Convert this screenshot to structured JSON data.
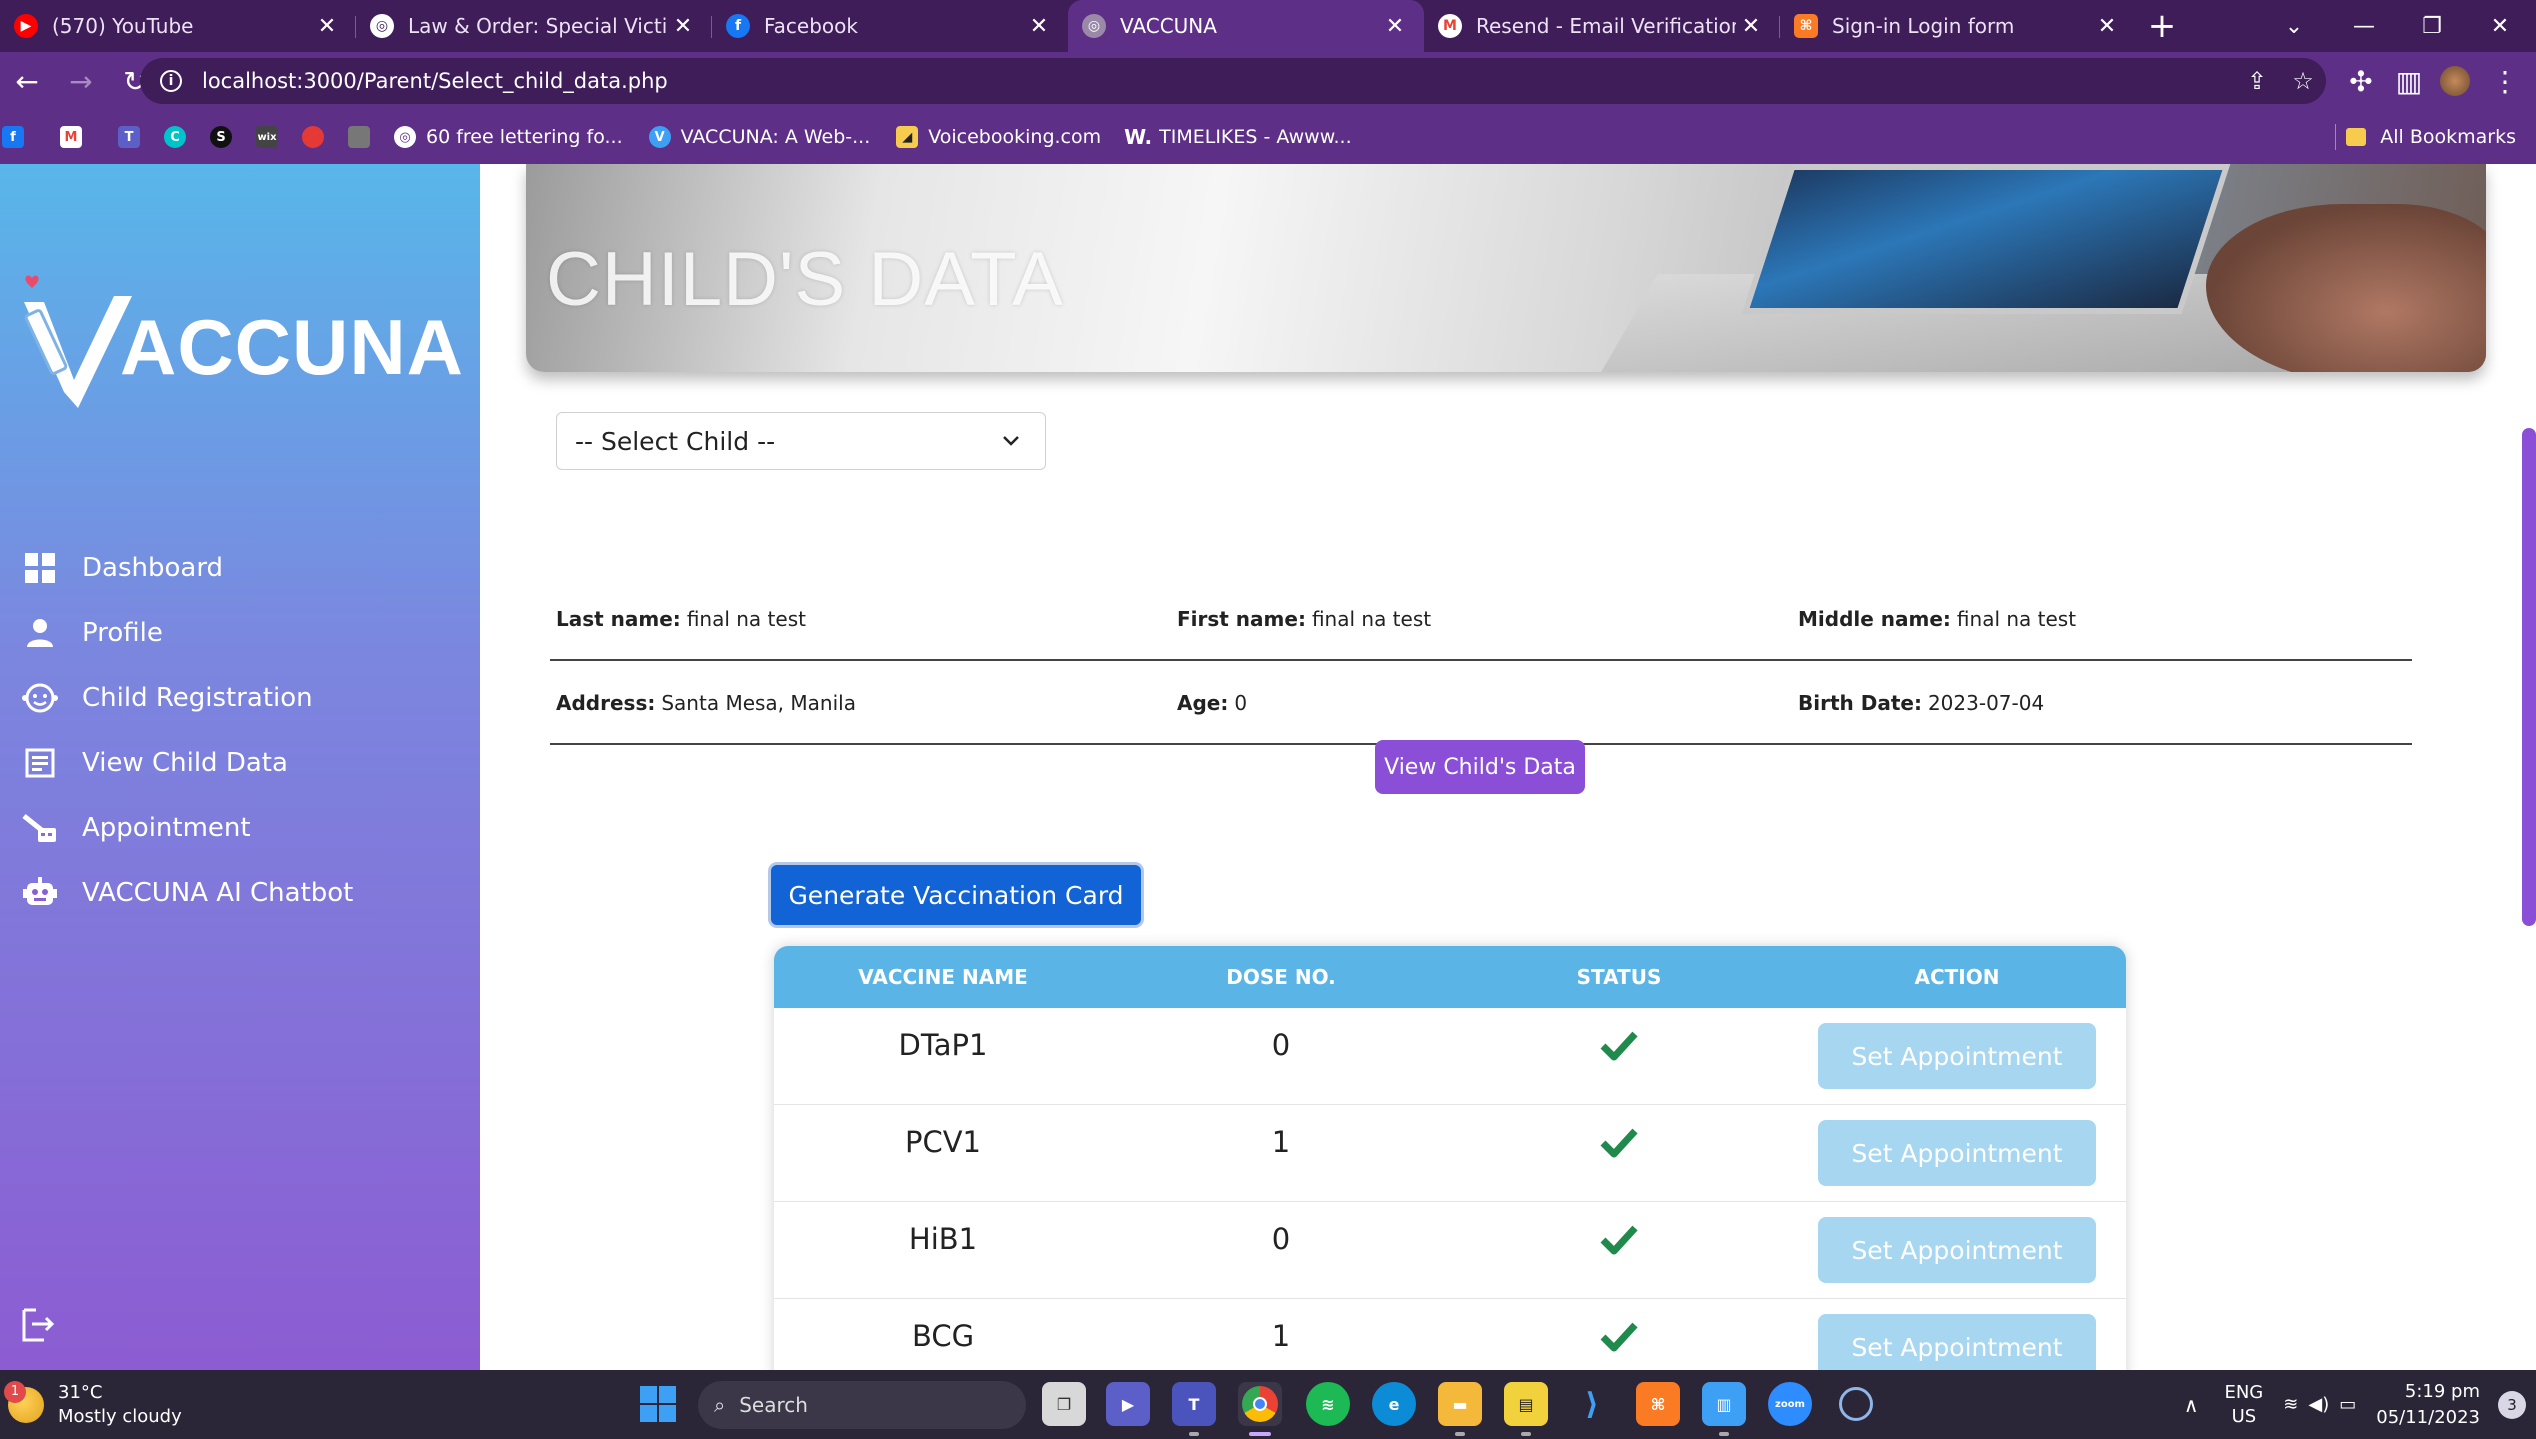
{
  "browser": {
    "tabs": [
      {
        "title": "(570) YouTube",
        "icon": "youtube-icon",
        "color": "#ff0000",
        "active": false
      },
      {
        "title": "Law & Order: Special Victims Un",
        "icon": "globe-icon",
        "color": "#ffffff",
        "active": false
      },
      {
        "title": "Facebook",
        "icon": "facebook-icon",
        "color": "#1877f2",
        "active": false
      },
      {
        "title": "VACCUNA",
        "icon": "globe-icon",
        "color": "#9a8aa8",
        "active": true
      },
      {
        "title": "Resend - Email Verification from",
        "icon": "gmail-icon",
        "color": "#ea4335",
        "active": false
      },
      {
        "title": "Sign-in Login form",
        "icon": "xampp-icon",
        "color": "#fb7a24",
        "active": false
      }
    ],
    "new_tab_label": "+",
    "url": "localhost:3000/Parent/Select_child_data.php",
    "bookmarks": [
      {
        "label": "60 free lettering fo...",
        "icon": "globe-icon",
        "color": "#ffffff"
      },
      {
        "label": "VACCUNA: A Web-...",
        "icon": "vaccuna-icon",
        "color": "#3ea0f5"
      },
      {
        "label": "Voicebooking.com",
        "icon": "voicebooking-icon",
        "color": "#f7cb4d"
      },
      {
        "label": "TIMELIKES - Awww...",
        "icon": "w-icon",
        "color": "#5e2f86"
      }
    ],
    "all_bookmarks_label": "All Bookmarks"
  },
  "sidebar": {
    "logo_text": "ACCUNA",
    "nav": [
      {
        "label": "Dashboard",
        "icon": "dashboard-icon"
      },
      {
        "label": "Profile",
        "icon": "user-icon"
      },
      {
        "label": "Child Registration",
        "icon": "baby-face-icon"
      },
      {
        "label": "View Child Data",
        "icon": "document-icon"
      },
      {
        "label": "Appointment",
        "icon": "syringe-calendar-icon"
      },
      {
        "label": "VACCUNA AI Chatbot",
        "icon": "robot-icon"
      }
    ]
  },
  "main": {
    "banner_title": "CHILD'S DATA",
    "select_child": {
      "selected": "-- Select Child --"
    },
    "child_info": {
      "last_name_label": "Last name:",
      "last_name": "final na test",
      "first_name_label": "First name:",
      "first_name": "final na test",
      "middle_name_label": "Middle name:",
      "middle_name": "final na test",
      "address_label": "Address:",
      "address": "Santa Mesa, Manila",
      "age_label": "Age:",
      "age": "0",
      "birth_date_label": "Birth Date:",
      "birth_date": "2023-07-04"
    },
    "view_button": "View Child's Data",
    "generate_button": "Generate Vaccination Card",
    "table": {
      "headers": [
        "VACCINE NAME",
        "DOSE NO.",
        "STATUS",
        "ACTION"
      ],
      "rows": [
        {
          "vaccine": "DTaP1",
          "dose": "0",
          "status": "completed",
          "action": "Set Appointment"
        },
        {
          "vaccine": "PCV1",
          "dose": "1",
          "status": "completed",
          "action": "Set Appointment"
        },
        {
          "vaccine": "HiB1",
          "dose": "0",
          "status": "completed",
          "action": "Set Appointment"
        },
        {
          "vaccine": "BCG",
          "dose": "1",
          "status": "completed",
          "action": "Set Appointment"
        }
      ]
    }
  },
  "taskbar": {
    "weather_temp": "31°C",
    "weather_desc": "Mostly cloudy",
    "weather_badge": "1",
    "search_placeholder": "Search",
    "lang_line1": "ENG",
    "lang_line2": "US",
    "time": "5:19 pm",
    "date": "05/11/2023",
    "notification_count": "3"
  },
  "colors": {
    "tab_bar": "#3e1d59",
    "toolbar": "#5e2f86",
    "sidebar_top": "#58b6ea",
    "sidebar_bottom": "#8c5cd2",
    "primary_purple": "#8a4fd6",
    "primary_blue": "#1163d6",
    "table_header": "#5bb4e6",
    "check_green": "#1f8a4c",
    "set_appointment_disabled": "#a7d6f1"
  }
}
